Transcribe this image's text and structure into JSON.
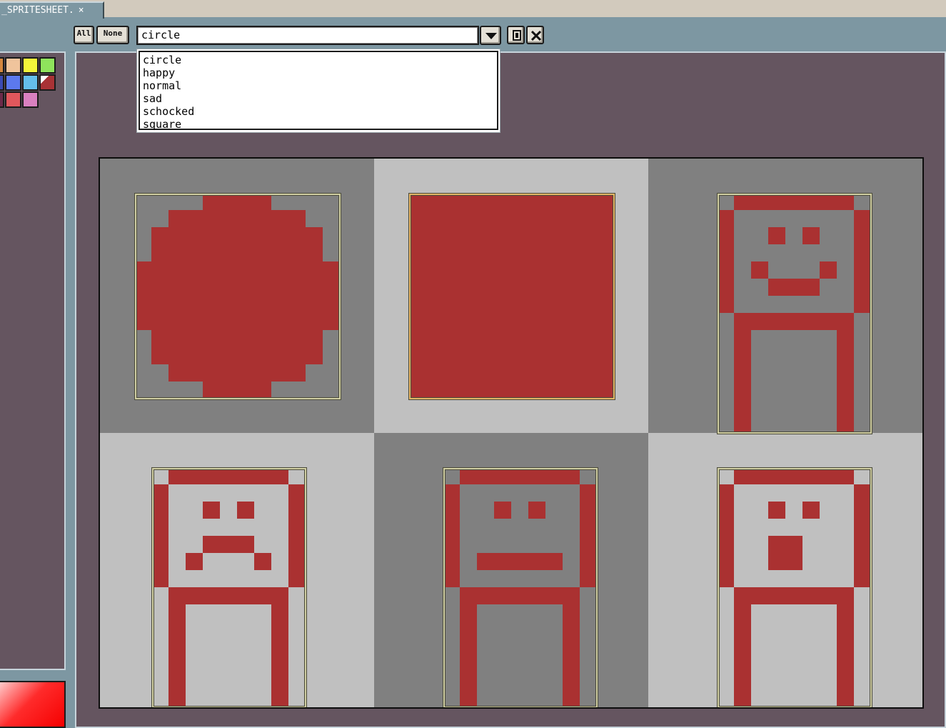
{
  "tab": {
    "title": "_SPRITESHEET.",
    "close_glyph": "×"
  },
  "toolbar": {
    "all_label": "All",
    "none_label": "None",
    "slice_value": "circle",
    "dropdown_icon": "chevron-down-icon",
    "lock_icon": "lock-icon",
    "delete_icon": "close-icon"
  },
  "slice_dropdown": {
    "options": [
      "circle",
      "happy",
      "normal",
      "sad",
      "schocked",
      "square"
    ]
  },
  "palette": {
    "colors": [
      "#f0c49c",
      "#f2f43a",
      "#8fe35c",
      "#5c79ee",
      "#64bfec",
      "#a83235",
      "#e0575c",
      "#d980c0"
    ]
  },
  "colors": {
    "sprite": "#aa3131",
    "checker_dark": "#808080",
    "checker_light": "#c0c0c0",
    "panel_bg": "#655560",
    "ui_bg": "#7d97a2",
    "slice_border": "#cfcda2",
    "selected_slice_border": "#e3b465"
  }
}
